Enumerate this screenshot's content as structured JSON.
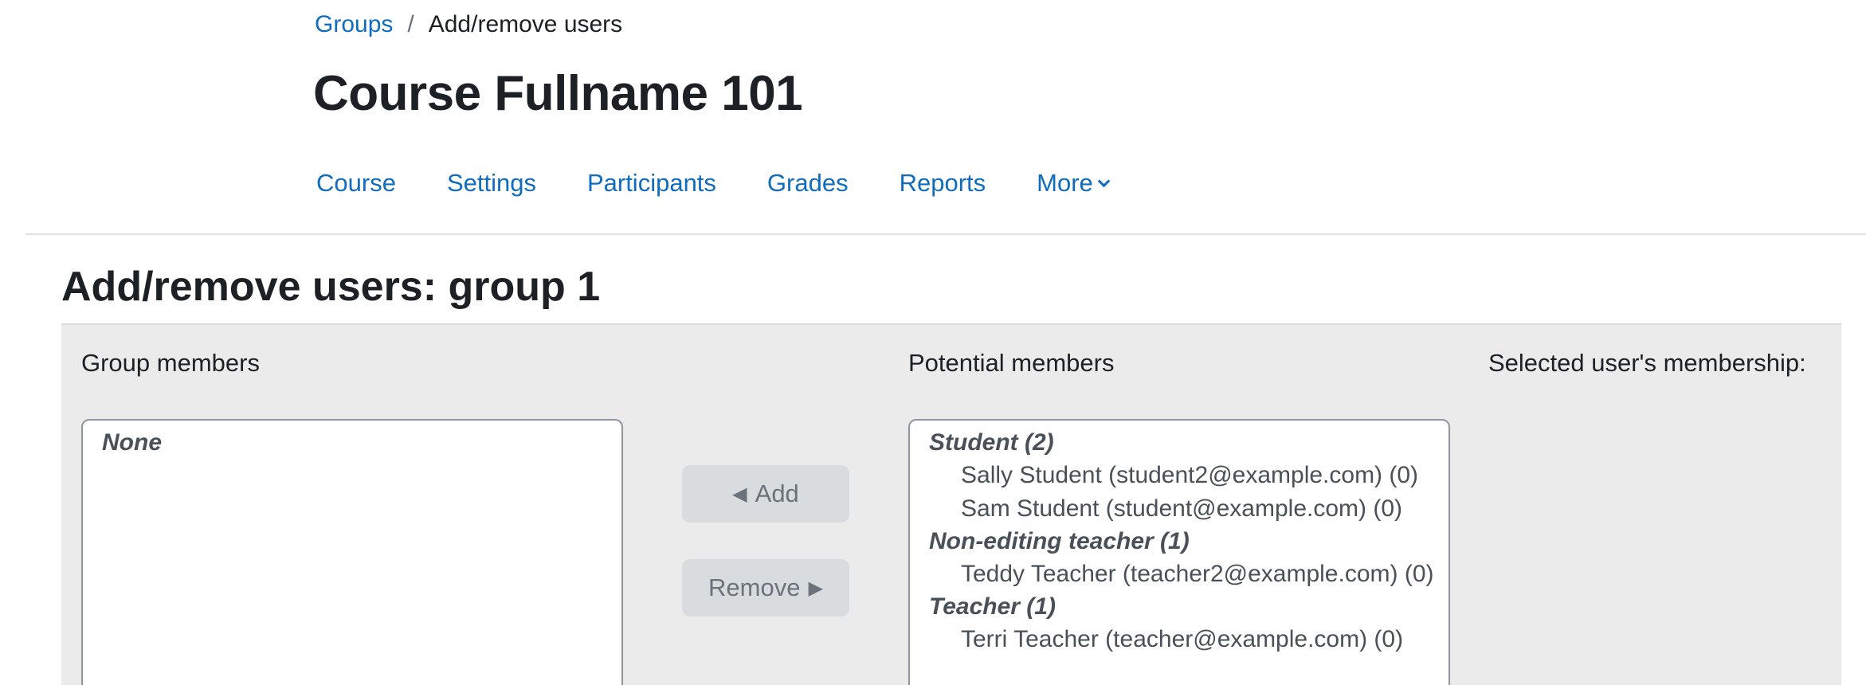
{
  "breadcrumb": {
    "parent": "Groups",
    "separator": "/",
    "current": "Add/remove users"
  },
  "course": {
    "title": "Course Fullname 101"
  },
  "nav": {
    "items": [
      "Course",
      "Settings",
      "Participants",
      "Grades",
      "Reports"
    ],
    "more": "More"
  },
  "page": {
    "heading": "Add/remove users: group 1"
  },
  "panel": {
    "group_members_label": "Group members",
    "potential_members_label": "Potential members",
    "membership_label": "Selected user's membership:",
    "group_members_empty": "None",
    "add_button": "Add",
    "remove_button": "Remove",
    "add_arrow": "◀",
    "remove_arrow": "▶",
    "potential": {
      "groups": [
        {
          "label": "Student (2)",
          "members": [
            "Sally Student (student2@example.com) (0)",
            "Sam Student (student@example.com) (0)"
          ]
        },
        {
          "label": "Non-editing teacher (1)",
          "members": [
            "Teddy Teacher (teacher2@example.com) (0)"
          ]
        },
        {
          "label": "Teacher (1)",
          "members": [
            "Terri Teacher (teacher@example.com) (0)"
          ]
        }
      ]
    }
  }
}
